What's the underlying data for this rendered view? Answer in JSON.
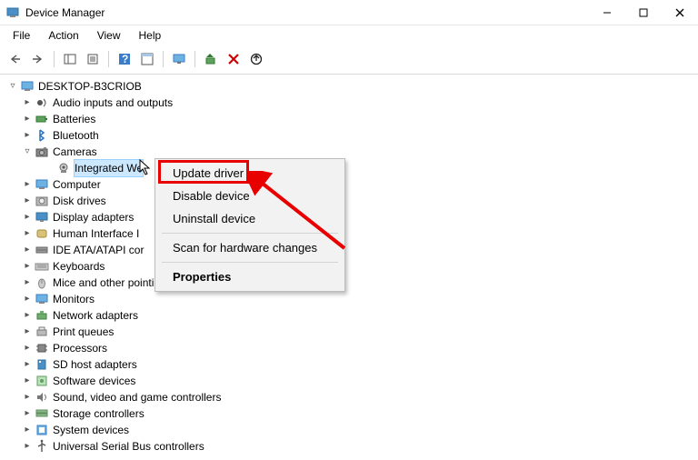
{
  "title": "Device Manager",
  "menus": {
    "file": "File",
    "action": "Action",
    "view": "View",
    "help": "Help"
  },
  "root": "DESKTOP-B3CRIOB",
  "nodes": [
    {
      "label": "Audio inputs and outputs",
      "icon": "audio"
    },
    {
      "label": "Batteries",
      "icon": "battery"
    },
    {
      "label": "Bluetooth",
      "icon": "bluetooth"
    },
    {
      "label": "Cameras",
      "icon": "camera",
      "expanded": true
    },
    {
      "label": "Integrated We",
      "icon": "webcam",
      "child": true,
      "selected": true
    },
    {
      "label": "Computer",
      "icon": "computer"
    },
    {
      "label": "Disk drives",
      "icon": "disk"
    },
    {
      "label": "Display adapters",
      "icon": "display"
    },
    {
      "label": "Human Interface I",
      "icon": "hid"
    },
    {
      "label": "IDE ATA/ATAPI cor",
      "icon": "ide"
    },
    {
      "label": "Keyboards",
      "icon": "keyboard"
    },
    {
      "label": "Mice and other pointing devices",
      "icon": "mouse"
    },
    {
      "label": "Monitors",
      "icon": "monitor"
    },
    {
      "label": "Network adapters",
      "icon": "network"
    },
    {
      "label": "Print queues",
      "icon": "print"
    },
    {
      "label": "Processors",
      "icon": "cpu"
    },
    {
      "label": "SD host adapters",
      "icon": "sd"
    },
    {
      "label": "Software devices",
      "icon": "soft"
    },
    {
      "label": "Sound, video and game controllers",
      "icon": "sound"
    },
    {
      "label": "Storage controllers",
      "icon": "storage"
    },
    {
      "label": "System devices",
      "icon": "system"
    },
    {
      "label": "Universal Serial Bus controllers",
      "icon": "usb"
    }
  ],
  "context": {
    "update": "Update driver",
    "disable": "Disable device",
    "uninstall": "Uninstall device",
    "scan": "Scan for hardware changes",
    "properties": "Properties"
  }
}
